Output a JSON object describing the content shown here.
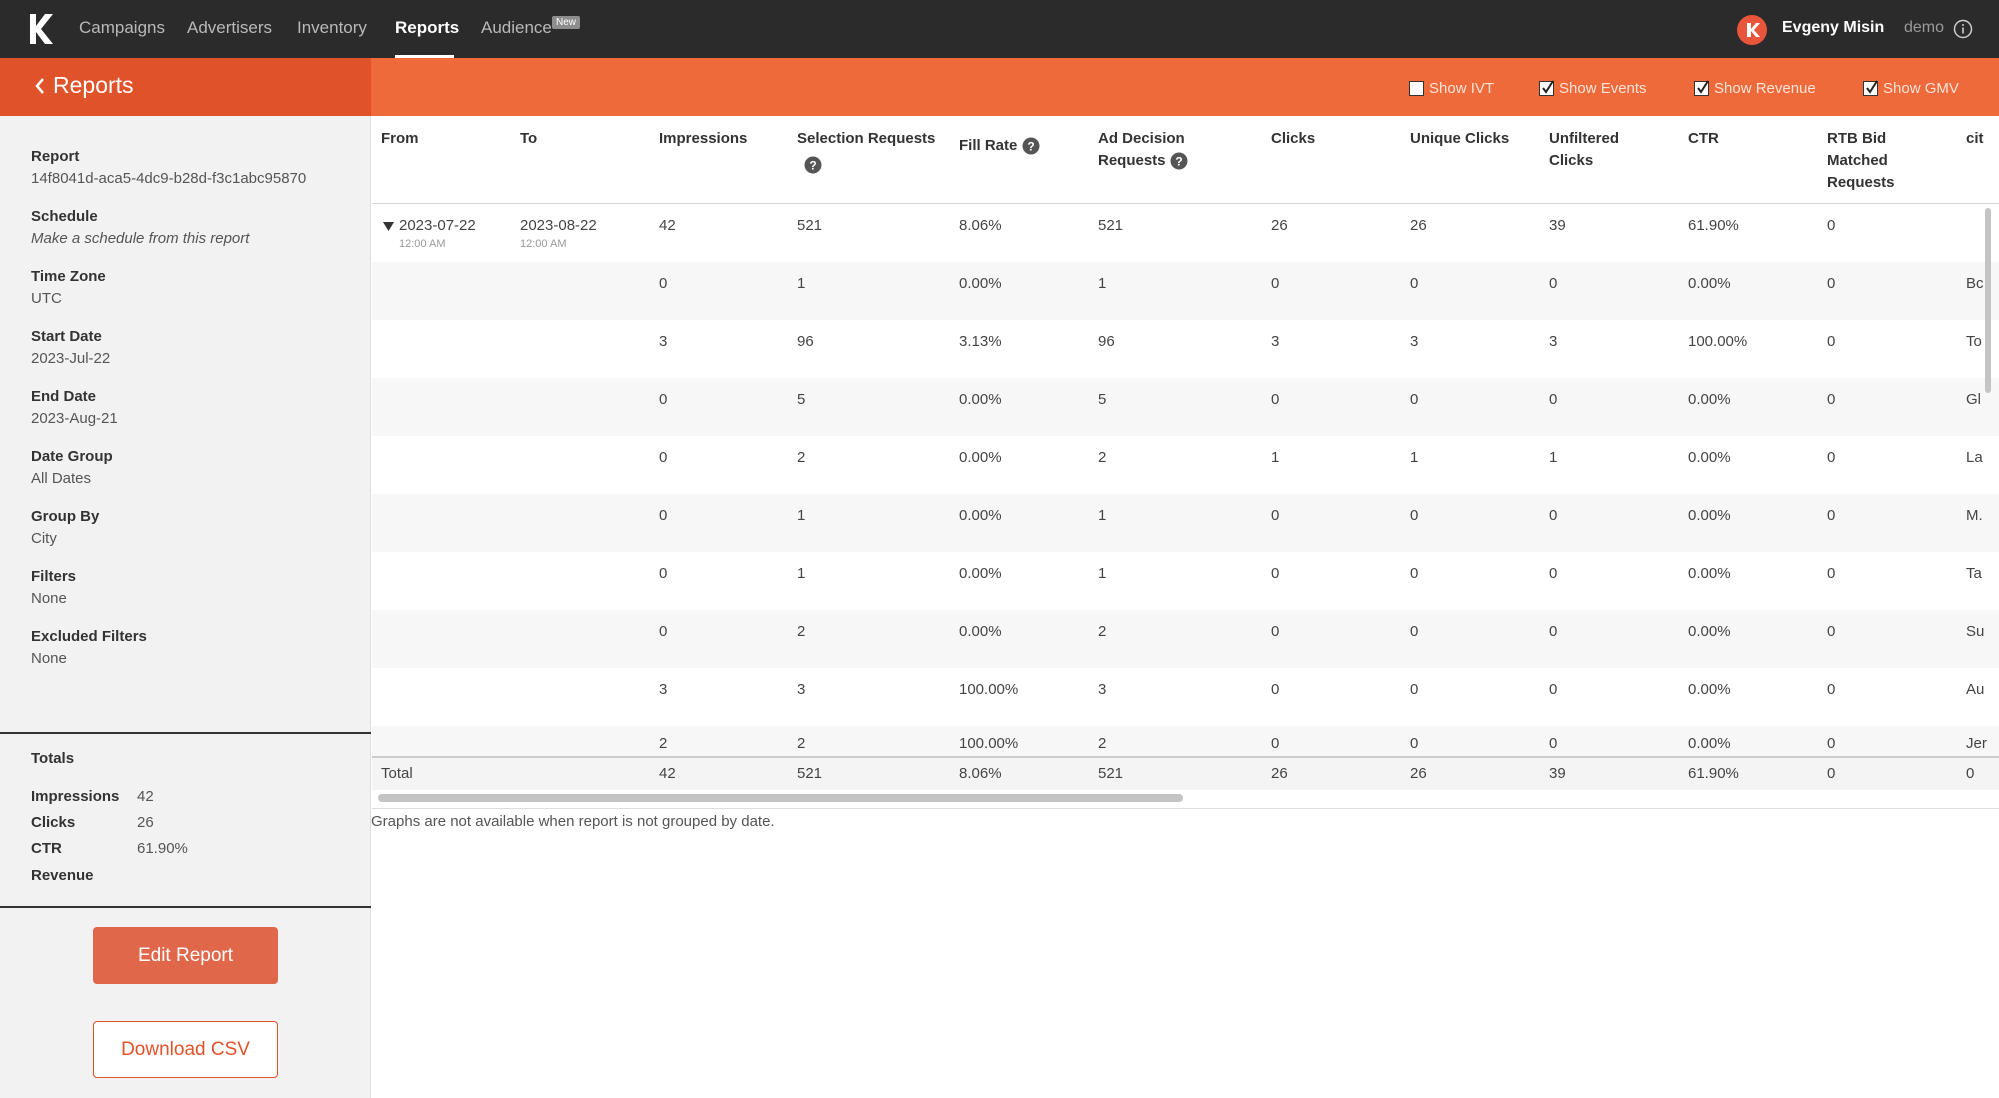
{
  "nav": {
    "items": [
      {
        "label": "Campaigns"
      },
      {
        "label": "Advertisers"
      },
      {
        "label": "Inventory"
      },
      {
        "label": "Reports"
      },
      {
        "label": "Audience"
      }
    ],
    "badge": "New",
    "user_name": "Evgeny Misin",
    "user_org": "demo",
    "icons": {
      "logo": "k-logo",
      "avatar": "user-avatar",
      "info": "info-icon"
    }
  },
  "header": {
    "title": "Reports",
    "toggles": [
      {
        "label": "Show IVT",
        "checked": false
      },
      {
        "label": "Show Events",
        "checked": true
      },
      {
        "label": "Show Revenue",
        "checked": true
      },
      {
        "label": "Show GMV",
        "checked": true
      }
    ]
  },
  "sidebar": {
    "fields": [
      {
        "label": "Report",
        "value": "14f8041d-aca5-4dc9-b28d-f3c1abc95870"
      },
      {
        "label": "Schedule",
        "value": "Make a schedule from this report"
      },
      {
        "label": "Time Zone",
        "value": "UTC"
      },
      {
        "label": "Start Date",
        "value": "2023-Jul-22"
      },
      {
        "label": "End Date",
        "value": "2023-Aug-21"
      },
      {
        "label": "Date Group",
        "value": "All Dates"
      },
      {
        "label": "Group By",
        "value": "City"
      },
      {
        "label": "Filters",
        "value": "None"
      },
      {
        "label": "Excluded Filters",
        "value": "None"
      }
    ],
    "totals_title": "Totals",
    "totals": [
      {
        "label": "Impressions",
        "value": "42"
      },
      {
        "label": "Clicks",
        "value": "26"
      },
      {
        "label": "CTR",
        "value": "61.90%"
      },
      {
        "label": "Revenue",
        "value": ""
      }
    ],
    "edit_label": "Edit Report",
    "csv_label": "Download CSV"
  },
  "table": {
    "columns": [
      "From",
      "To",
      "Impressions",
      "Selection Requests",
      "Fill Rate",
      "Ad Decision Requests",
      "Clicks",
      "Unique Clicks",
      "Unfiltered Clicks",
      "CTR",
      "RTB Bid Matched Requests",
      "cit"
    ],
    "first_row": {
      "from_date": "2023-07-22",
      "from_time": "12:00 AM",
      "to_date": "2023-08-22",
      "to_time": "12:00 AM",
      "values": [
        "42",
        "521",
        "8.06%",
        "521",
        "26",
        "26",
        "39",
        "61.90%",
        "0",
        ""
      ]
    },
    "rows": [
      [
        "0",
        "1",
        "0.00%",
        "1",
        "0",
        "0",
        "0",
        "0.00%",
        "0",
        "Bc"
      ],
      [
        "3",
        "96",
        "3.13%",
        "96",
        "3",
        "3",
        "3",
        "100.00%",
        "0",
        "To"
      ],
      [
        "0",
        "5",
        "0.00%",
        "5",
        "0",
        "0",
        "0",
        "0.00%",
        "0",
        "Gl"
      ],
      [
        "0",
        "2",
        "0.00%",
        "2",
        "1",
        "1",
        "1",
        "0.00%",
        "0",
        "La"
      ],
      [
        "0",
        "1",
        "0.00%",
        "1",
        "0",
        "0",
        "0",
        "0.00%",
        "0",
        "M."
      ],
      [
        "0",
        "1",
        "0.00%",
        "1",
        "0",
        "0",
        "0",
        "0.00%",
        "0",
        "Ta"
      ],
      [
        "0",
        "2",
        "0.00%",
        "2",
        "0",
        "0",
        "0",
        "0.00%",
        "0",
        "Su"
      ],
      [
        "3",
        "3",
        "100.00%",
        "3",
        "0",
        "0",
        "0",
        "0.00%",
        "0",
        "Au"
      ],
      [
        "2",
        "2",
        "100.00%",
        "2",
        "0",
        "0",
        "0",
        "0.00%",
        "0",
        "Jer"
      ]
    ],
    "total": {
      "label": "Total",
      "values": [
        "42",
        "521",
        "8.06%",
        "521",
        "26",
        "26",
        "39",
        "61.90%",
        "0",
        "0"
      ]
    }
  },
  "notice": "Graphs are not available when report is not grouped by date.",
  "colors": {
    "topbar": "#2b2b2b",
    "accent_dark": "#e0522a",
    "accent": "#ee6a3a",
    "button": "#e0674a"
  }
}
